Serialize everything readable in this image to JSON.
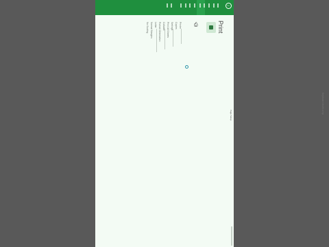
{
  "dialog": {
    "title": "Print",
    "back_icon": "back-arrow-icon",
    "thumbnail_icon": "document-preview-icon",
    "option_texts": [
      "Printer",
      "Copies",
      "Settings",
      "Print All Sheets",
      "Collated",
      "Portrait Orientation",
      "Letter",
      "Normal Margins",
      "No Scaling"
    ],
    "footer_text": "Page Setup",
    "loading_icon": "spinner-icon"
  },
  "topbar": {
    "accent": "#1f8f3e"
  },
  "ghost_text": "Keyboard shortcut tip"
}
